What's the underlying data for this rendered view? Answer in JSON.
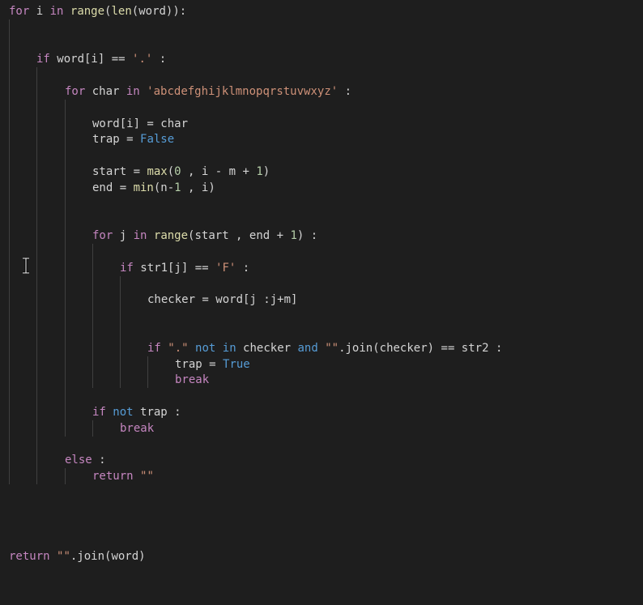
{
  "code": {
    "lines": [
      [
        {
          "t": "for",
          "c": "kw"
        },
        {
          "t": " i "
        },
        {
          "t": "in",
          "c": "kw"
        },
        {
          "t": " "
        },
        {
          "t": "range",
          "c": "fn"
        },
        {
          "t": "("
        },
        {
          "t": "len",
          "c": "fn"
        },
        {
          "t": "(word)):"
        }
      ],
      [
        {
          "t": "if",
          "c": "kw"
        },
        {
          "t": " word[i] == "
        },
        {
          "t": "'.'",
          "c": "st"
        },
        {
          "t": " :"
        }
      ],
      [
        {
          "t": "for",
          "c": "kw"
        },
        {
          "t": " char "
        },
        {
          "t": "in",
          "c": "kw"
        },
        {
          "t": " "
        },
        {
          "t": "'abcdefghijklmnopqrstuvwxyz'",
          "c": "st"
        },
        {
          "t": " :"
        }
      ],
      [
        {
          "t": "word[i] = char"
        }
      ],
      [
        {
          "t": "trap = "
        },
        {
          "t": "False",
          "c": "kb"
        }
      ],
      [
        {
          "t": "start = "
        },
        {
          "t": "max",
          "c": "fn"
        },
        {
          "t": "("
        },
        {
          "t": "0",
          "c": "nm"
        },
        {
          "t": " , i - m + "
        },
        {
          "t": "1",
          "c": "nm"
        },
        {
          "t": ")"
        }
      ],
      [
        {
          "t": "end = "
        },
        {
          "t": "min",
          "c": "fn"
        },
        {
          "t": "(n-"
        },
        {
          "t": "1",
          "c": "nm"
        },
        {
          "t": " , i)"
        }
      ],
      [
        {
          "t": "for",
          "c": "kw"
        },
        {
          "t": " j "
        },
        {
          "t": "in",
          "c": "kw"
        },
        {
          "t": " "
        },
        {
          "t": "range",
          "c": "fn"
        },
        {
          "t": "(start , end + "
        },
        {
          "t": "1",
          "c": "nm"
        },
        {
          "t": ") :"
        }
      ],
      [
        {
          "t": "if",
          "c": "kw"
        },
        {
          "t": " str1[j] == "
        },
        {
          "t": "'F'",
          "c": "st"
        },
        {
          "t": " :"
        }
      ],
      [
        {
          "t": "checker = word[j :j+m]"
        }
      ],
      [
        {
          "t": "if",
          "c": "kw"
        },
        {
          "t": " "
        },
        {
          "t": "\".\"",
          "c": "st"
        },
        {
          "t": " "
        },
        {
          "t": "not",
          "c": "kb"
        },
        {
          "t": " "
        },
        {
          "t": "in",
          "c": "kb"
        },
        {
          "t": " checker "
        },
        {
          "t": "and",
          "c": "kb"
        },
        {
          "t": " "
        },
        {
          "t": "\"\"",
          "c": "st"
        },
        {
          "t": ".join(checker) == str2 :"
        }
      ],
      [
        {
          "t": "trap = "
        },
        {
          "t": "True",
          "c": "kb"
        }
      ],
      [
        {
          "t": "break",
          "c": "kw"
        }
      ],
      [
        {
          "t": "if",
          "c": "kw"
        },
        {
          "t": " "
        },
        {
          "t": "not",
          "c": "kb"
        },
        {
          "t": " trap :"
        }
      ],
      [
        {
          "t": "break",
          "c": "kw"
        }
      ],
      [
        {
          "t": "else",
          "c": "kw"
        },
        {
          "t": " :"
        }
      ],
      [
        {
          "t": "return",
          "c": "kw"
        },
        {
          "t": " "
        },
        {
          "t": "\"\"",
          "c": "st"
        }
      ],
      [
        {
          "t": "return",
          "c": "kw"
        },
        {
          "t": " "
        },
        {
          "t": "\"\"",
          "c": "st"
        },
        {
          "t": ".join(word)"
        }
      ]
    ]
  },
  "colors": {
    "background": "#1e1e1e",
    "text": "#d4d4d4",
    "keyword_control": "#c586c0",
    "keyword_constant": "#569cd6",
    "function": "#dcdcaa",
    "string": "#ce9178",
    "number": "#b5cea8",
    "indent_guide": "#404040"
  },
  "cursor": {
    "icon": "text-ibeam-cursor-icon"
  }
}
